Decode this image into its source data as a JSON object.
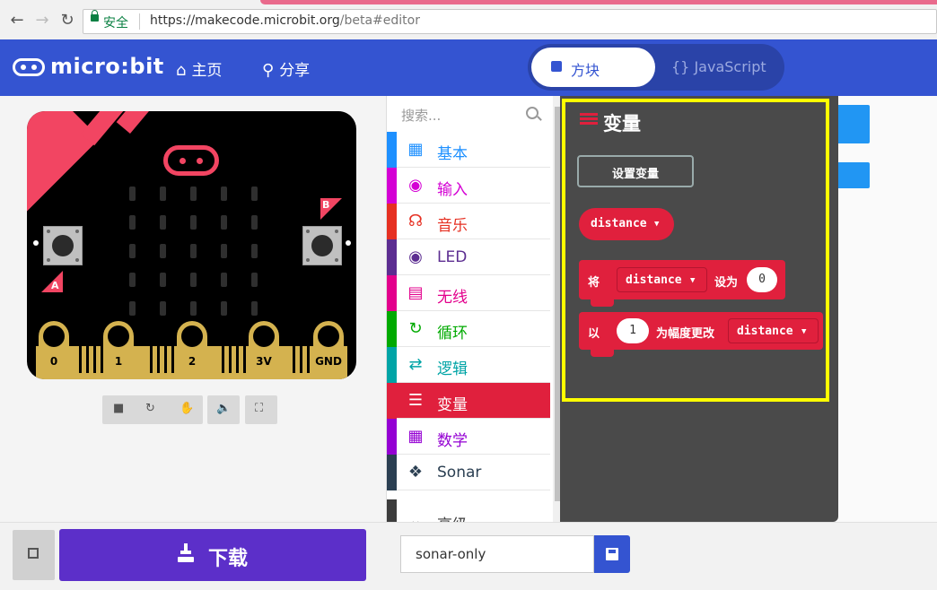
{
  "browser": {
    "secure_label": "安全",
    "url_main": "https://makecode.microbit.org",
    "url_rest": "/beta#editor"
  },
  "header": {
    "logo_text": "micro:bit",
    "home_label": "主页",
    "share_label": "分享",
    "blocks_label": "方块",
    "javascript_label": "{} JavaScript"
  },
  "simulator": {
    "button_a": "A",
    "button_b": "B",
    "pins": [
      "0",
      "1",
      "2",
      "3V",
      "GND"
    ],
    "controls": [
      "stop-icon",
      "restart-icon",
      "slowmo-icon",
      "mute-icon",
      "fullscreen-icon"
    ]
  },
  "toolbox": {
    "search_placeholder": "搜索...",
    "categories": [
      {
        "label": "基本",
        "color": "#1e90ff",
        "icon": "grid-icon"
      },
      {
        "label": "输入",
        "color": "#d400d4",
        "icon": "target-icon"
      },
      {
        "label": "音乐",
        "color": "#e63022",
        "icon": "headphones-icon"
      },
      {
        "label": "LED",
        "color": "#5c2d91",
        "icon": "toggle-icon"
      },
      {
        "label": "无线",
        "color": "#e3008c",
        "icon": "signal-icon"
      },
      {
        "label": "循环",
        "color": "#00aa00",
        "icon": "loop-icon"
      },
      {
        "label": "逻辑",
        "color": "#00a4a6",
        "icon": "shuffle-icon"
      },
      {
        "label": "变量",
        "color": "#e0203d",
        "icon": "lines-icon"
      },
      {
        "label": "数学",
        "color": "#9400d3",
        "icon": "calculator-icon"
      },
      {
        "label": "Sonar",
        "color": "#2b3f52",
        "icon": "puzzle-icon"
      },
      {
        "label": "高级",
        "color": "#3c3c3c",
        "icon": "chevron-down-icon"
      }
    ]
  },
  "flyout": {
    "title": "变量",
    "set_var_button": "设置变量",
    "var_name": "distance",
    "set_block": {
      "prefix": "将",
      "var": "distance",
      "middle": "设为",
      "value": "0"
    },
    "change_block": {
      "prefix": "以",
      "value": "1",
      "middle": "为幅度更改",
      "var": "distance"
    }
  },
  "bottom": {
    "download_label": "下载",
    "project_name": "sonar-only"
  },
  "colors": {
    "brand_blue": "#3454d1",
    "variables_red": "#e0203d",
    "download_purple": "#5c2fc9",
    "highlight_yellow": "#ffff00"
  }
}
